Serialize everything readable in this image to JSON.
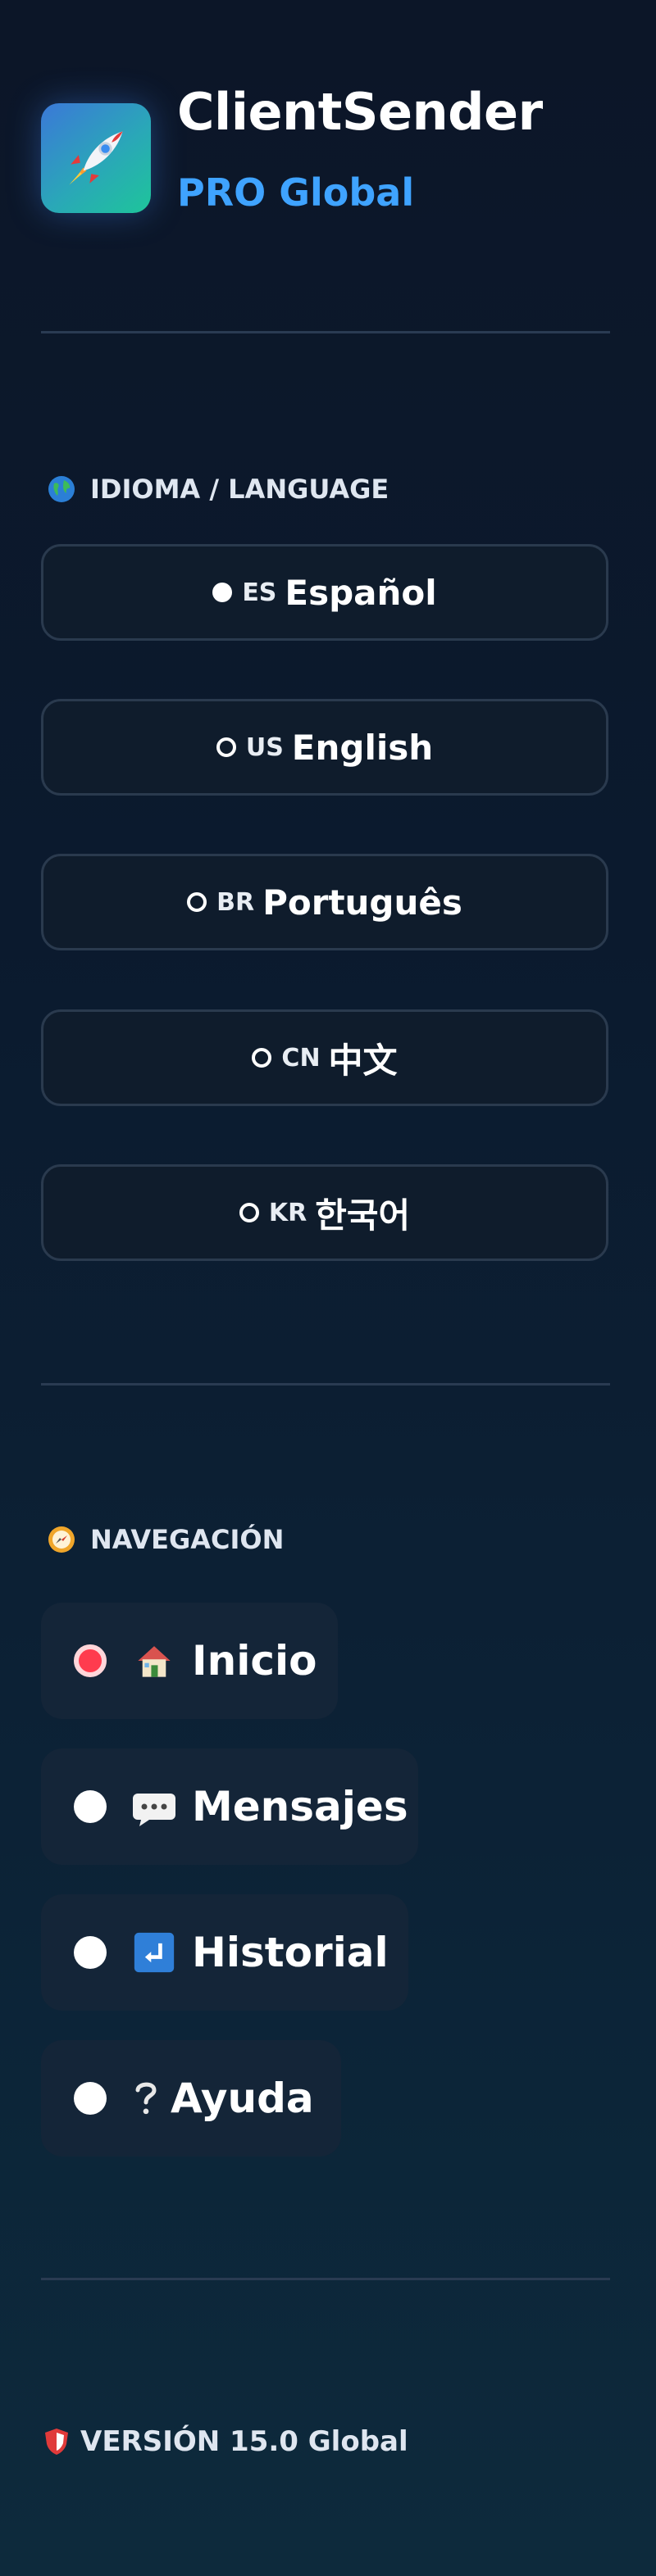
{
  "header": {
    "title": "ClientSender",
    "subtitle": "PRO Global",
    "logo_icon": "rocket-icon"
  },
  "language_section": {
    "title": "IDIOMA / LANGUAGE",
    "icon": "globe-icon",
    "options": [
      {
        "code": "ES",
        "label": "Español",
        "selected": true
      },
      {
        "code": "US",
        "label": "English",
        "selected": false
      },
      {
        "code": "BR",
        "label": "Português",
        "selected": false
      },
      {
        "code": "CN",
        "label": "中文",
        "selected": false
      },
      {
        "code": "KR",
        "label": "한국어",
        "selected": false
      }
    ]
  },
  "navigation": {
    "title": "NAVEGACIÓN",
    "icon": "compass-icon",
    "items": [
      {
        "label": "Inicio",
        "icon": "house-icon",
        "active": true
      },
      {
        "label": "Mensajes",
        "icon": "speech-bubble-icon",
        "active": false
      },
      {
        "label": "Historial",
        "icon": "return-arrow-icon",
        "active": false
      },
      {
        "label": "Ayuda",
        "icon": "question-mark-icon",
        "active": false
      }
    ]
  },
  "footer": {
    "version_text": "VERSIÓN 15.0 Global",
    "icon": "shield-icon"
  },
  "colors": {
    "accent": "#3fa3ff",
    "active_dot": "#ff3b4e",
    "background_top": "#0c1628",
    "background_bottom": "#0d2a3c"
  }
}
